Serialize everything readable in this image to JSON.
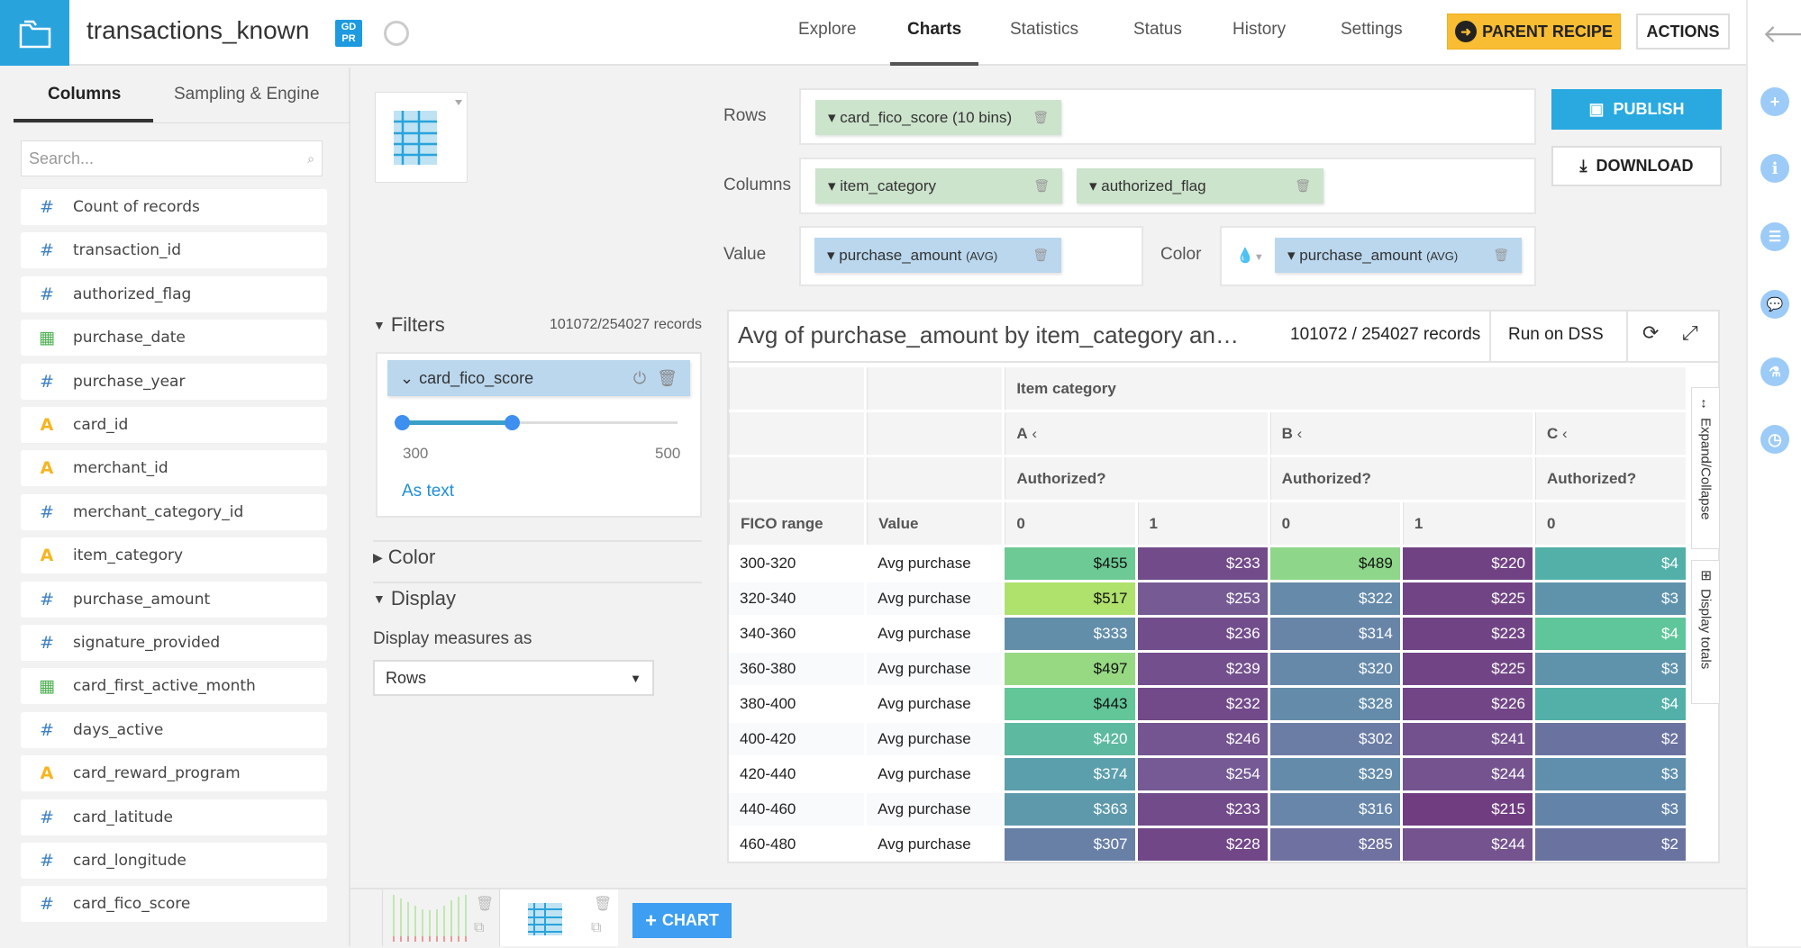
{
  "header": {
    "title": "transactions_known",
    "gdpr_badge": "GD PR",
    "nav": [
      "Explore",
      "Charts",
      "Statistics",
      "Status",
      "History",
      "Settings"
    ],
    "active_nav": "Charts",
    "parent_recipe_label": "PARENT RECIPE",
    "actions_label": "ACTIONS"
  },
  "left_panel": {
    "tabs": [
      "Columns",
      "Sampling & Engine"
    ],
    "search_placeholder": "Search...",
    "columns": [
      {
        "type": "num",
        "name": "Count of records"
      },
      {
        "type": "num",
        "name": "transaction_id"
      },
      {
        "type": "num",
        "name": "authorized_flag"
      },
      {
        "type": "date",
        "name": "purchase_date"
      },
      {
        "type": "num",
        "name": "purchase_year"
      },
      {
        "type": "str",
        "name": "card_id"
      },
      {
        "type": "str",
        "name": "merchant_id"
      },
      {
        "type": "num",
        "name": "merchant_category_id"
      },
      {
        "type": "str",
        "name": "item_category"
      },
      {
        "type": "num",
        "name": "purchase_amount"
      },
      {
        "type": "num",
        "name": "signature_provided"
      },
      {
        "type": "date",
        "name": "card_first_active_month"
      },
      {
        "type": "num",
        "name": "days_active"
      },
      {
        "type": "str",
        "name": "card_reward_program"
      },
      {
        "type": "num",
        "name": "card_latitude"
      },
      {
        "type": "num",
        "name": "card_longitude"
      },
      {
        "type": "num",
        "name": "card_fico_score"
      }
    ]
  },
  "shelves": {
    "rows_label": "Rows",
    "rows_pill": "card_fico_score (10 bins)",
    "columns_label": "Columns",
    "columns_pills": [
      "item_category",
      "authorized_flag"
    ],
    "value_label": "Value",
    "value_pill": "purchase_amount",
    "value_agg": "(AVG)",
    "color_label": "Color",
    "color_pill": "purchase_amount",
    "color_agg": "(AVG)"
  },
  "buttons": {
    "publish": "PUBLISH",
    "download": "DOWNLOAD",
    "add_chart": "CHART"
  },
  "filters": {
    "title": "Filters",
    "records": "101072/254027 records",
    "filter_name": "card_fico_score",
    "min_label": "300",
    "max_label": "500",
    "range_selected": [
      300,
      380
    ],
    "as_text": "As text"
  },
  "sections": {
    "color": "Color",
    "display": "Display",
    "display_measures_label": "Display measures as",
    "display_measures_value": "Rows"
  },
  "chart": {
    "title": "Avg of purchase_amount by item_category an…",
    "records": "101072 / 254027 records",
    "run_on": "Run on DSS",
    "expand_collapse": "Expand/Collapse",
    "display_totals": "Display totals",
    "header_item_category": "Item category",
    "categories": [
      "A",
      "B",
      "C"
    ],
    "authorized_label": "Authorized?",
    "row_header": "FICO range",
    "value_header": "Value",
    "sub_cols": [
      "0",
      "1",
      "0",
      "1",
      "0"
    ],
    "value_label": "Avg purchase",
    "color_stops": [
      [
        215,
        "#6f3d80"
      ],
      [
        260,
        "#765f98"
      ],
      [
        320,
        "#6689aa"
      ],
      [
        380,
        "#5aa0ac"
      ],
      [
        440,
        "#5fc59a"
      ],
      [
        490,
        "#8fd68a"
      ],
      [
        520,
        "#b3e26a"
      ]
    ],
    "rows": [
      {
        "range": "300-320",
        "cells": [
          "$455",
          "$233",
          "$489",
          "$220"
        ],
        "c0": "$4",
        "c0_color": "#52b0a8"
      },
      {
        "range": "320-340",
        "cells": [
          "$517",
          "$253",
          "$322",
          "$225"
        ],
        "c0": "$3",
        "c0_color": "#5f93ac"
      },
      {
        "range": "340-360",
        "cells": [
          "$333",
          "$236",
          "$314",
          "$223"
        ],
        "c0": "$4",
        "c0_color": "#5fc59a"
      },
      {
        "range": "360-380",
        "cells": [
          "$497",
          "$239",
          "$320",
          "$225"
        ],
        "c0": "$3",
        "c0_color": "#5f93ac"
      },
      {
        "range": "380-400",
        "cells": [
          "$443",
          "$232",
          "$328",
          "$226"
        ],
        "c0": "$4",
        "c0_color": "#52b0a8"
      },
      {
        "range": "400-420",
        "cells": [
          "$420",
          "$246",
          "$302",
          "$241"
        ],
        "c0": "$2",
        "c0_color": "#6a73a0"
      },
      {
        "range": "420-440",
        "cells": [
          "$374",
          "$254",
          "$329",
          "$244"
        ],
        "c0": "$3",
        "c0_color": "#5f8fac"
      },
      {
        "range": "440-460",
        "cells": [
          "$363",
          "$233",
          "$316",
          "$215"
        ],
        "c0": "$3",
        "c0_color": "#6384a8"
      },
      {
        "range": "460-480",
        "cells": [
          "$307",
          "$228",
          "$285",
          "$244"
        ],
        "c0": "$2",
        "c0_color": "#6a73a0"
      }
    ]
  }
}
